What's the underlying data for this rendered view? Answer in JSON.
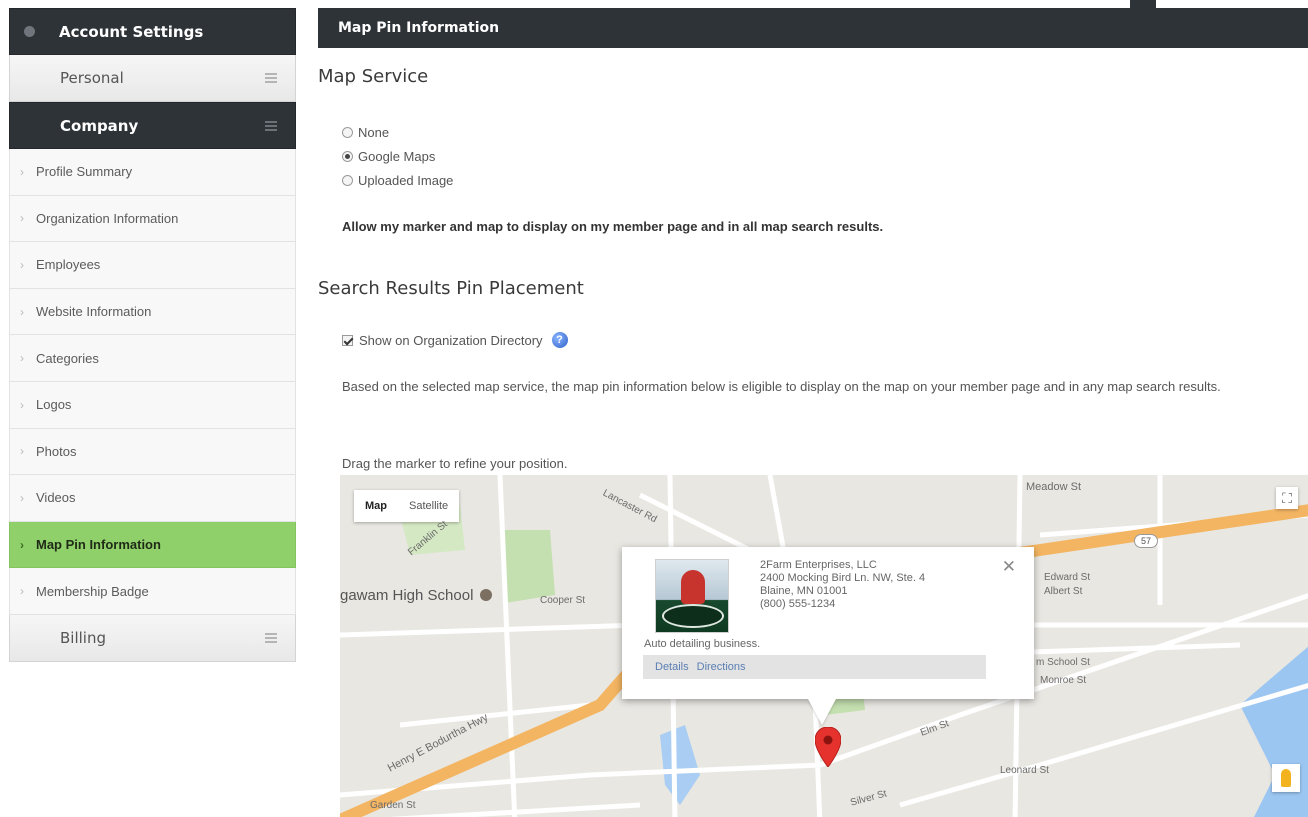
{
  "sidebar": {
    "header": "Account Settings",
    "groups": {
      "personal": "Personal",
      "company": "Company",
      "billing": "Billing"
    },
    "items": [
      {
        "label": "Profile Summary"
      },
      {
        "label": "Organization Information"
      },
      {
        "label": "Employees"
      },
      {
        "label": "Website Information"
      },
      {
        "label": "Categories"
      },
      {
        "label": "Logos"
      },
      {
        "label": "Photos"
      },
      {
        "label": "Videos"
      },
      {
        "label": "Map Pin Information",
        "active": true
      },
      {
        "label": "Membership Badge"
      }
    ]
  },
  "main": {
    "header": "Map Pin Information",
    "map_service": {
      "title": "Map Service",
      "options": [
        {
          "label": "None",
          "selected": false
        },
        {
          "label": "Google Maps",
          "selected": true
        },
        {
          "label": "Uploaded Image",
          "selected": false
        }
      ],
      "allow_text": "Allow my marker and map to display on my member page and in all map search results."
    },
    "pin_placement": {
      "title": "Search Results Pin Placement",
      "show_label": "Show on Organization Directory",
      "show_checked": true,
      "description": "Based on the selected map service, the map pin information below is eligible to display on the map on your member page and in any map search results.",
      "drag_text": "Drag the marker to refine your position."
    },
    "map": {
      "type_buttons": [
        "Map",
        "Satellite"
      ],
      "selected_type": "Map",
      "labels": {
        "school": "gawam High School",
        "henry": "Henry E Bodurtha Hwy",
        "meadow": "Meadow St",
        "route": "57",
        "edward": "Edward St",
        "albert": "Albert St",
        "school_st": "m School St",
        "monroe": "Monroe St",
        "garden": "Garden St",
        "leonard": "Leonard St",
        "elm": "Elm St",
        "silver": "Silver St",
        "cooper": "Cooper St",
        "lancaster": "Lancaster Rd",
        "franklin": "Franklin St"
      },
      "info_window": {
        "name": "2Farm Enterprises, LLC",
        "address1": "2400 Mocking Bird Ln. NW, Ste. 4",
        "address2": "Blaine, MN 01001",
        "phone": "(800) 555-1234",
        "description": "Auto detailing business.",
        "links": [
          "Details",
          "Directions"
        ]
      }
    }
  },
  "colors": {
    "dark_header": "#2e3338",
    "active_item": "#8fd06a",
    "map_road_major": "#f3b562",
    "marker": "#e5322d"
  }
}
